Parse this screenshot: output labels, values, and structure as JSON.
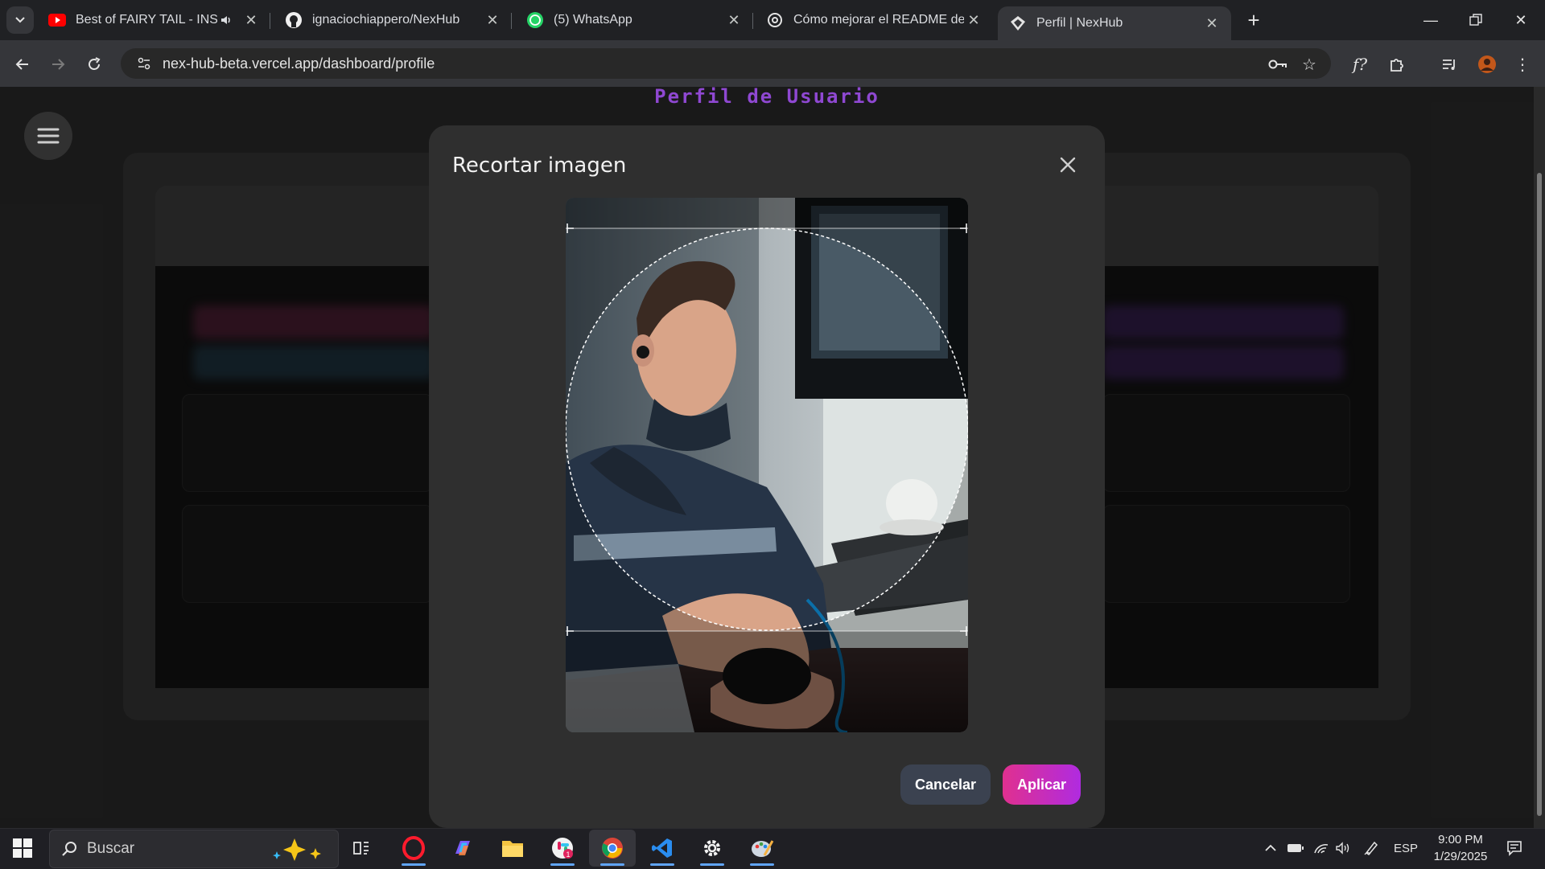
{
  "browser": {
    "tabs": [
      {
        "title": "Best of FAIRY TAIL - INSANE",
        "icon": "youtube-icon"
      },
      {
        "title": "ignaciochiappero/NexHub",
        "icon": "github-icon"
      },
      {
        "title": "(5) WhatsApp",
        "icon": "whatsapp-icon"
      },
      {
        "title": "Cómo mejorar el README de u",
        "icon": "chatgpt-icon"
      },
      {
        "title": "Perfil | NexHub",
        "icon": "nexhub-icon"
      }
    ],
    "url": "nex-hub-beta.vercel.app/dashboard/profile"
  },
  "page": {
    "title": "Perfil de Usuario"
  },
  "modal": {
    "title": "Recortar imagen",
    "cancel_label": "Cancelar",
    "apply_label": "Aplicar"
  },
  "taskbar": {
    "search_placeholder": "Buscar",
    "language": "ESP",
    "time": "9:00 PM",
    "date": "1/29/2025"
  },
  "colors": {
    "accent_purple": "#a855f7",
    "apply_gradient_start": "#e0308f",
    "apply_gradient_end": "#b02be0",
    "cancel_bg": "#3b4250"
  }
}
